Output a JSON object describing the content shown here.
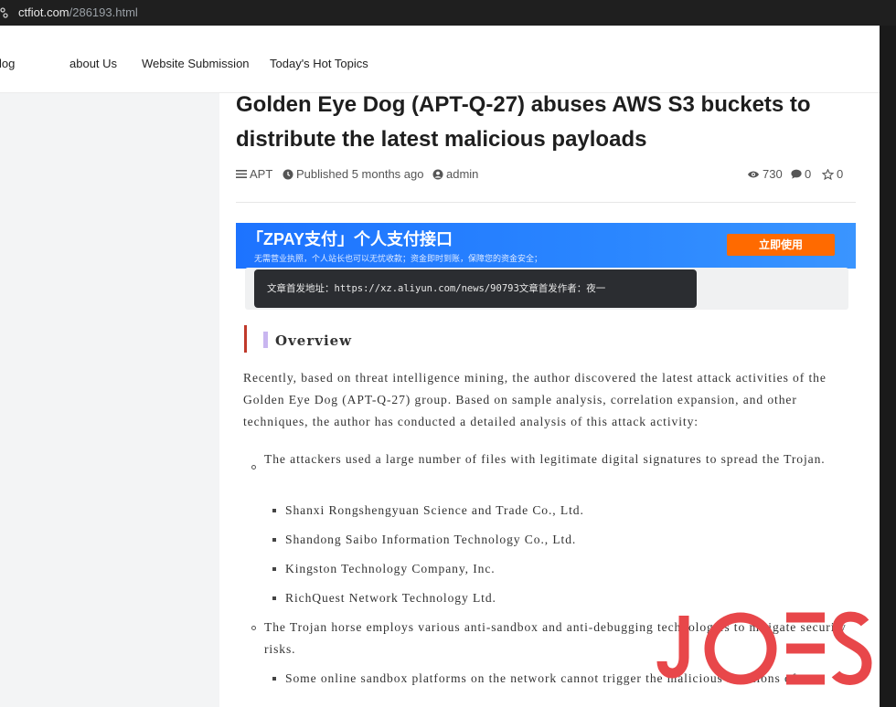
{
  "browser": {
    "url_domain": "ctfiot.com",
    "url_path": "/286193.html"
  },
  "nav": {
    "items": [
      "log",
      "about Us",
      "Website Submission",
      "Today's Hot Topics"
    ]
  },
  "article": {
    "title": "Golden Eye Dog (APT-Q-27) abuses AWS S3 buckets to distribute the latest malicious payloads",
    "meta": {
      "category": "APT",
      "published": "Published 5 months ago",
      "author": "admin",
      "views": "730",
      "comments": "0",
      "favorites": "0"
    },
    "ad": {
      "title": "「ZPAY支付」个人支付接口",
      "subtitle": "无需营业执照，个人站长也可以无忧收款；资金即时到账，保障您的资金安全；",
      "button": "立即使用"
    },
    "notice": "文章首发地址：https://xz.aliyun.com/news/90793文章首发作者：夜一",
    "section_title": "Overview",
    "intro": "Recently, based on threat intelligence mining, the author discovered the latest attack activities of the Golden Eye Dog (APT-Q-27) group. Based on sample analysis, correlation expansion, and other techniques, the author has conducted a detailed analysis of this attack activity:",
    "list": [
      {
        "text": "The attackers used a large number of files with legitimate digital signatures to spread the Trojan.",
        "subitems": [
          "Shanxi Rongshengyuan Science and Trade Co., Ltd.",
          "Shandong Saibo Information Technology Co., Ltd.",
          "Kingston Technology Company, Inc.",
          "RichQuest Network Technology Ltd."
        ]
      },
      {
        "text": "The Trojan horse employs various anti-sandbox and anti-debugging technologies to mitigate security risks.",
        "subitems": [
          "Some online sandbox platforms on the network cannot trigger the malicious functions of"
        ]
      }
    ]
  },
  "watermark": {
    "text": "JOES",
    "color": "#e8474a"
  },
  "colors": {
    "accent_red": "#c0392b",
    "ad_blue": "#1d73ff",
    "ad_orange": "#ff6a00"
  }
}
